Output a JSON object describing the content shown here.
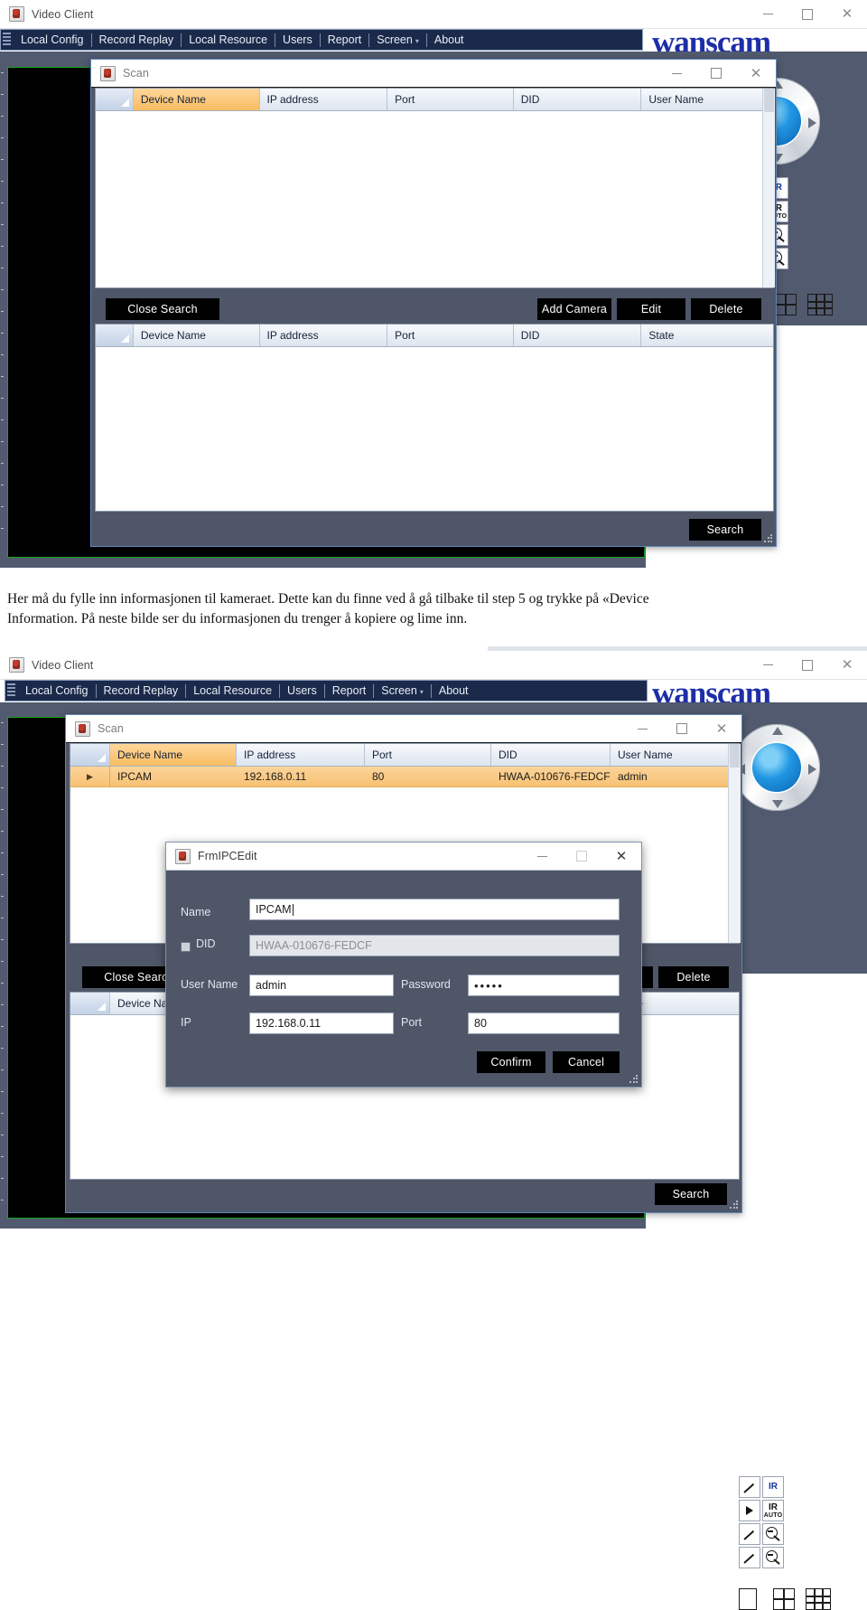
{
  "app": {
    "title": "Video Client",
    "brand": "wanscam",
    "window_controls": {
      "minimize": "minimize-icon",
      "maximize": "maximize-icon",
      "close": "close-icon"
    },
    "menu": [
      {
        "label": "Local Config"
      },
      {
        "label": "Record Replay"
      },
      {
        "label": "Local Resource"
      },
      {
        "label": "Users"
      },
      {
        "label": "Report"
      },
      {
        "label": "Screen",
        "caret": "▾"
      },
      {
        "label": "About"
      }
    ]
  },
  "controls": {
    "ptz_label": "ptz-joystick",
    "ir_label": "IR",
    "ir_auto_top": "IR",
    "ir_auto_bottom": "AUTO",
    "layout_1": "layout-1-view",
    "layout_4": "layout-4-view",
    "layout_9": "layout-9-view"
  },
  "scan_dialog": {
    "title": "Scan",
    "search_results": {
      "columns": [
        "",
        "Device Name",
        "IP address",
        "Port",
        "DID",
        "User Name"
      ],
      "rows_top": [],
      "rows_bottom": [
        {
          "marker": "▶",
          "device_name": "IPCAM",
          "ip": "192.168.0.11",
          "port": "80",
          "did": "HWAA-010676-FEDCF",
          "user": "admin"
        }
      ]
    },
    "device_list": {
      "columns": [
        "",
        "Device Name",
        "IP address",
        "Port",
        "DID",
        "State"
      ],
      "rows": []
    },
    "buttons": {
      "close_search": "Close Search",
      "add_camera": "Add Camera",
      "edit": "Edit",
      "delete": "Delete",
      "search": "Search"
    }
  },
  "edit_dialog": {
    "title": "FrmIPCEdit",
    "fields": {
      "name_label": "Name",
      "name_value": "IPCAM",
      "did_label": "DID",
      "did_value": "HWAA-010676-FEDCF",
      "username_label": "User Name",
      "username_value": "admin",
      "password_label": "Password",
      "password_value": "•••••",
      "ip_label": "IP",
      "ip_value": "192.168.0.11",
      "port_label": "Port",
      "port_value": "80"
    },
    "buttons": {
      "confirm": "Confirm",
      "cancel": "Cancel"
    }
  },
  "caption": {
    "line1": "Her må du fylle inn informasjonen til kameraet. Dette kan du finne ved å gå tilbake til step 5 og trykke på «Device",
    "line2": "Information. På neste bilde ser du informasjonen du trenger å kopiere og lime inn."
  },
  "colors": {
    "menu_bg": "#1b2a4a",
    "brand": "#1d2ea8",
    "dialog_bg": "#4e5668",
    "row_highlight": "#f7c173",
    "video_border": "#16a81c"
  }
}
